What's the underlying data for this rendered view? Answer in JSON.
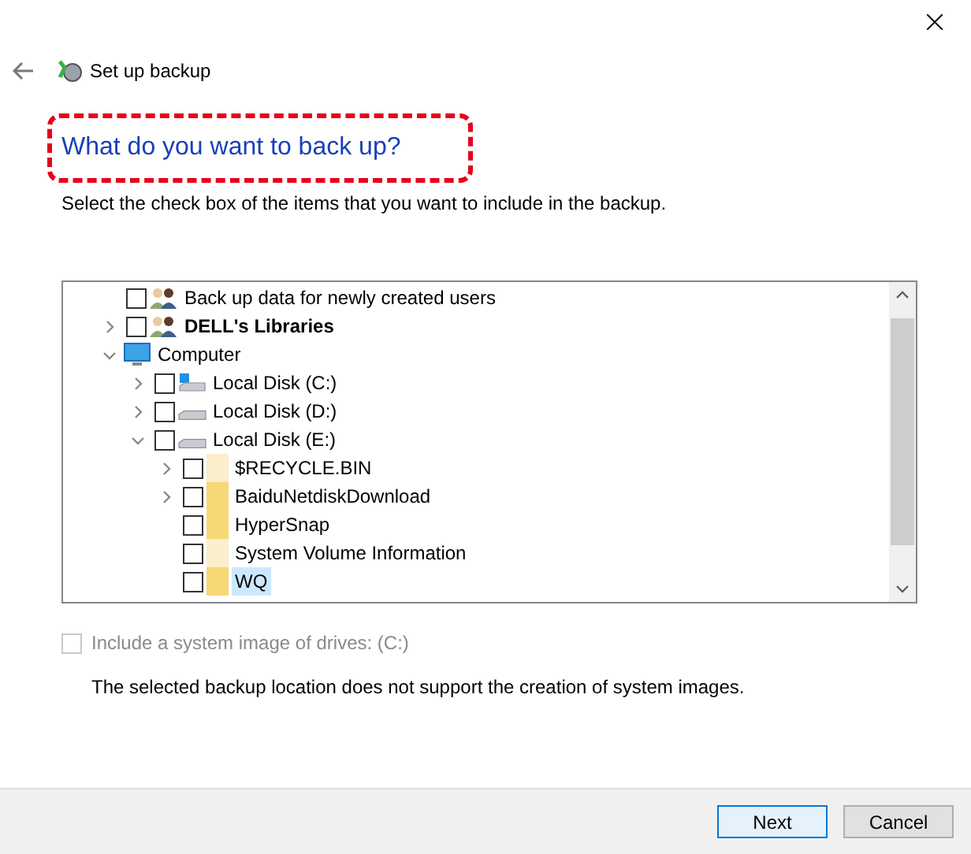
{
  "header": {
    "title": "Set up backup"
  },
  "heading": "What do you want to back up?",
  "instruction": "Select the check box of the items that you want to include in the backup.",
  "tree": [
    {
      "label": "Back up data for newly created users",
      "kind": "users",
      "checked": false,
      "bold": false
    },
    {
      "label": "DELL's Libraries",
      "kind": "users",
      "checked": false,
      "bold": true,
      "expanded": false
    },
    {
      "label": "Computer",
      "kind": "computer",
      "expanded": true,
      "children": [
        {
          "label": "Local Disk (C:)",
          "kind": "system-drive",
          "checked": false,
          "expanded": false
        },
        {
          "label": "Local Disk (D:)",
          "kind": "drive",
          "checked": false,
          "expanded": false
        },
        {
          "label": "Local Disk (E:)",
          "kind": "drive",
          "checked": false,
          "expanded": true,
          "children": [
            {
              "label": "$RECYCLE.BIN",
              "kind": "folder",
              "hidden": true,
              "checked": false,
              "expanded": false,
              "selected": false
            },
            {
              "label": "BaiduNetdiskDownload",
              "kind": "folder",
              "hidden": false,
              "checked": false,
              "expanded": false,
              "selected": false
            },
            {
              "label": "HyperSnap",
              "kind": "folder",
              "hidden": false,
              "checked": false,
              "selected": false
            },
            {
              "label": "System Volume Information",
              "kind": "folder",
              "hidden": true,
              "checked": false,
              "selected": false
            },
            {
              "label": "WQ",
              "kind": "folder",
              "hidden": false,
              "checked": false,
              "selected": true
            }
          ]
        }
      ]
    }
  ],
  "system_image": {
    "label": "Include a system image of drives: (C:)",
    "checked": false,
    "disabled": true
  },
  "note": "The selected backup location does not support the creation of system images.",
  "buttons": [
    {
      "label": "Next",
      "kind": "default"
    },
    {
      "label": "Cancel",
      "kind": "normal"
    }
  ]
}
